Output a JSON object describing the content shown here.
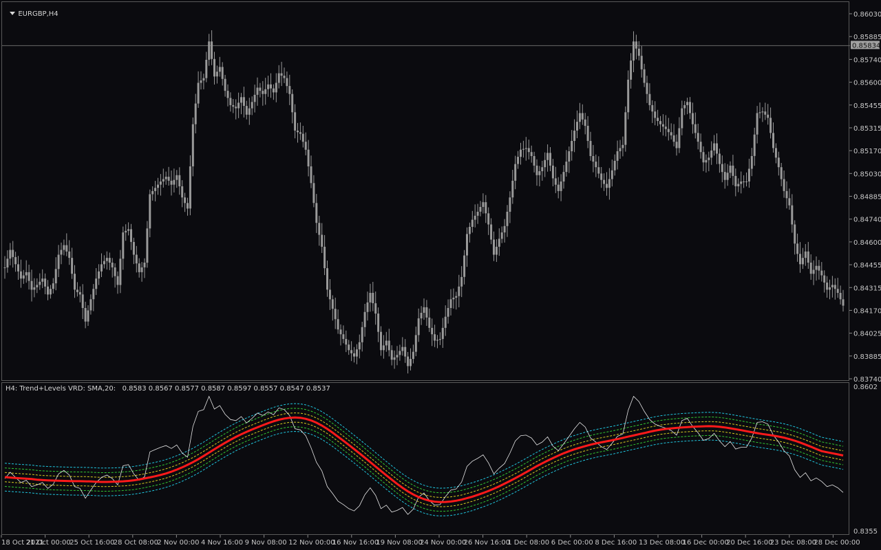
{
  "chart_window": {
    "symbol_label": "EURGBP,H4",
    "current_price": "0.85834",
    "price_axis": [
      "0.86030",
      "0.85885",
      "0.85740",
      "0.85600",
      "0.85455",
      "0.85315",
      "0.85170",
      "0.85030",
      "0.84885",
      "0.84740",
      "0.84600",
      "0.84455",
      "0.84315",
      "0.84170",
      "0.84025",
      "0.83885",
      "0.83740"
    ],
    "price_range": [
      0.8374,
      0.8603
    ]
  },
  "indicator_window": {
    "title": "H4: Trend+Levels VRD: SMA,20:",
    "values": "0.8583 0.8567 0.8577 0.8587 0.8597 0.8557 0.8547 0.8537",
    "axis_top": "0.8602",
    "axis_bottom": "0.8355"
  },
  "time_axis": [
    "18 Oct 2021",
    "21 Oct 00:00",
    "25 Oct 16:00",
    "28 Oct 08:00",
    "2 Nov 00:00",
    "4 Nov 16:00",
    "9 Nov 08:00",
    "12 Nov 00:00",
    "16 Nov 16:00",
    "19 Nov 08:00",
    "24 Nov 00:00",
    "26 Nov 16:00",
    "1 Dec 08:00",
    "6 Dec 00:00",
    "8 Dec 16:00",
    "13 Dec 08:00",
    "16 Dec 00:00",
    "20 Dec 16:00",
    "23 Dec 08:00",
    "28 Dec 00:00"
  ],
  "colors": {
    "background": "#0b0b0f",
    "candle": "#9a9a9a",
    "sma": "#ff1a1a",
    "level_inner": "#d8d020",
    "level_mid": "#33cc33",
    "level_outer": "#20c8e0",
    "price_line": "#e8e8e8"
  },
  "chart_data": {
    "type": "line",
    "title": "",
    "close_series": [
      0.8444,
      0.8455,
      0.8446,
      0.8437,
      0.8441,
      0.843,
      0.8433,
      0.8437,
      0.8427,
      0.8434,
      0.8452,
      0.8458,
      0.845,
      0.843,
      0.8427,
      0.841,
      0.8424,
      0.8437,
      0.8446,
      0.845,
      0.8444,
      0.8433,
      0.8466,
      0.8468,
      0.8452,
      0.8441,
      0.8447,
      0.849,
      0.8494,
      0.8498,
      0.8501,
      0.8496,
      0.8502,
      0.8488,
      0.8481,
      0.8534,
      0.856,
      0.8563,
      0.8586,
      0.8564,
      0.857,
      0.8555,
      0.8546,
      0.8544,
      0.8551,
      0.854,
      0.8548,
      0.8557,
      0.8553,
      0.8559,
      0.8554,
      0.8566,
      0.8563,
      0.8553,
      0.853,
      0.8528,
      0.8518,
      0.8497,
      0.8472,
      0.8457,
      0.843,
      0.8418,
      0.8405,
      0.8399,
      0.8392,
      0.8388,
      0.8397,
      0.8416,
      0.8428,
      0.8415,
      0.8392,
      0.8398,
      0.8386,
      0.8389,
      0.8394,
      0.8382,
      0.8391,
      0.8412,
      0.8419,
      0.8406,
      0.8398,
      0.8399,
      0.8413,
      0.8424,
      0.8426,
      0.8438,
      0.8465,
      0.8474,
      0.8479,
      0.8485,
      0.8471,
      0.8452,
      0.8462,
      0.847,
      0.8488,
      0.8509,
      0.8518,
      0.8519,
      0.8514,
      0.8502,
      0.8507,
      0.8516,
      0.85,
      0.8492,
      0.8504,
      0.8517,
      0.853,
      0.8541,
      0.8533,
      0.8514,
      0.8507,
      0.8499,
      0.8494,
      0.8505,
      0.8517,
      0.8521,
      0.8562,
      0.8586,
      0.8577,
      0.856,
      0.8546,
      0.8538,
      0.8534,
      0.8531,
      0.8527,
      0.8519,
      0.8544,
      0.8548,
      0.8534,
      0.8523,
      0.851,
      0.8513,
      0.8522,
      0.8509,
      0.8499,
      0.8508,
      0.8495,
      0.8498,
      0.8498,
      0.8514,
      0.8541,
      0.8542,
      0.8538,
      0.8519,
      0.8507,
      0.8492,
      0.8483,
      0.8459,
      0.8446,
      0.8454,
      0.844,
      0.8445,
      0.8439,
      0.843,
      0.8433,
      0.8428,
      0.842
    ],
    "sma_period": 20,
    "ylim": [
      0.8374,
      0.8603
    ]
  }
}
